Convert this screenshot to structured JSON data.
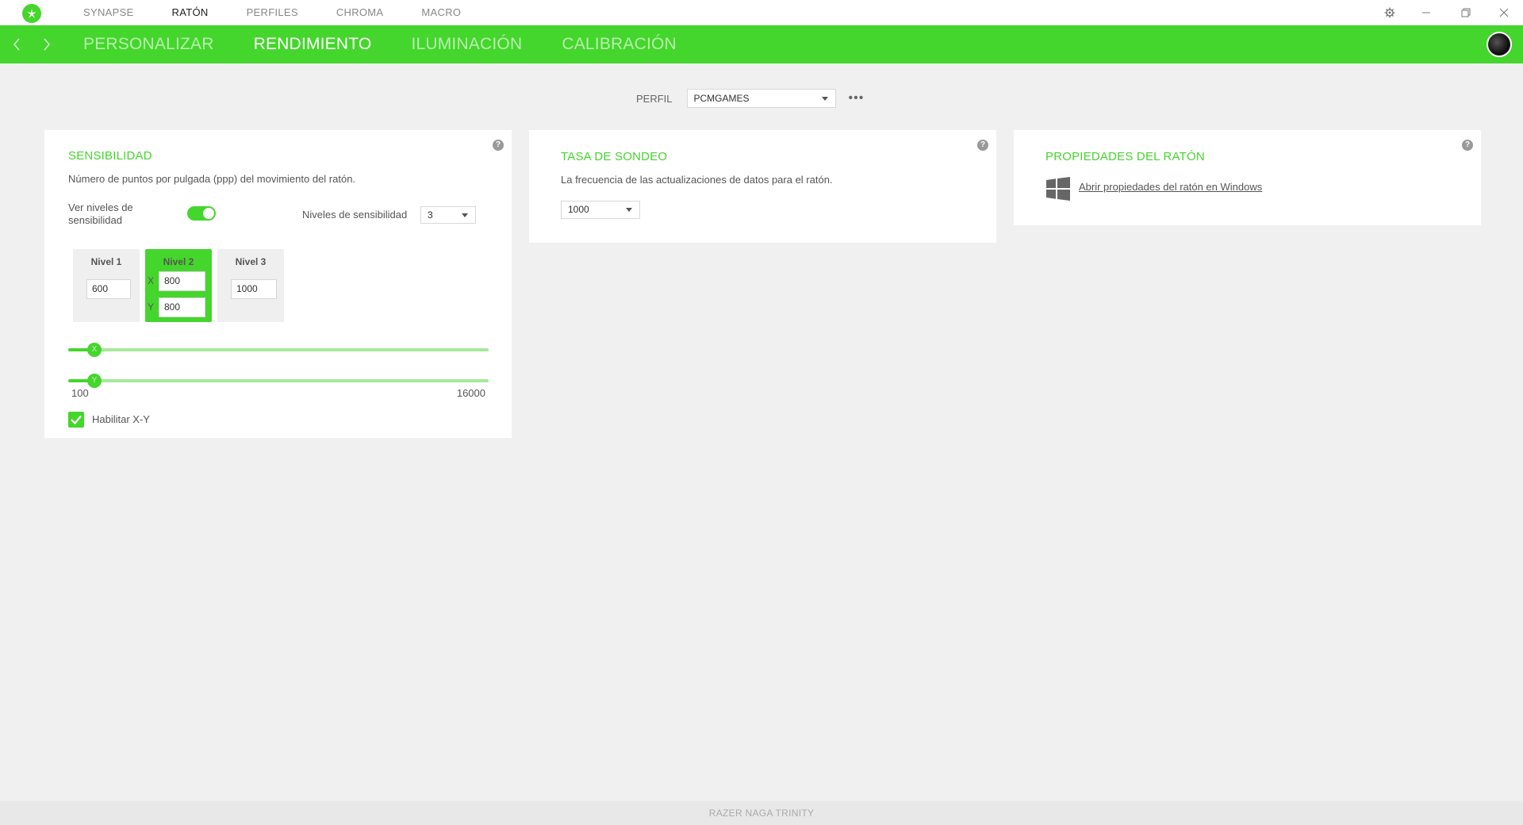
{
  "app": {
    "footer_device": "RAZER NAGA TRINITY"
  },
  "topnav": {
    "items": [
      {
        "label": "SYNAPSE"
      },
      {
        "label": "RATÓN"
      },
      {
        "label": "PERFILES"
      },
      {
        "label": "CHROMA"
      },
      {
        "label": "MACRO"
      }
    ],
    "active": "RATÓN"
  },
  "subnav": {
    "items": [
      {
        "label": "PERSONALIZAR"
      },
      {
        "label": "RENDIMIENTO"
      },
      {
        "label": "ILUMINACIÓN"
      },
      {
        "label": "CALIBRACIÓN"
      }
    ],
    "active": "RENDIMIENTO"
  },
  "profile": {
    "label": "PERFIL",
    "value": "PCMGAMES"
  },
  "sensitivity": {
    "title": "SENSIBILIDAD",
    "description": "Número de puntos por pulgada (ppp) del movimiento del ratón.",
    "toggle_label": "Ver niveles de sensibilidad",
    "toggle_on": true,
    "levels_label": "Niveles de sensibilidad",
    "levels_count": "3",
    "levels": [
      {
        "title": "Nivel 1",
        "value": "600"
      },
      {
        "title": "Nivel 2",
        "x": "800",
        "y": "800",
        "x_label": "X",
        "y_label": "Y"
      },
      {
        "title": "Nivel 3",
        "value": "1000"
      }
    ],
    "slider_x_label": "X",
    "slider_y_label": "Y",
    "min": "100",
    "max": "16000",
    "enable_xy_label": "Habilitar X-Y",
    "enable_xy": true
  },
  "polling": {
    "title": "TASA DE SONDEO",
    "description": "La frecuencia de las actualizaciones de datos para el ratón.",
    "value": "1000"
  },
  "mouse_props": {
    "title": "PROPIEDADES DEL RATÓN",
    "link": "Abrir propiedades del ratón en Windows"
  },
  "help_glyph": "?",
  "colors": {
    "accent": "#44d62c"
  }
}
